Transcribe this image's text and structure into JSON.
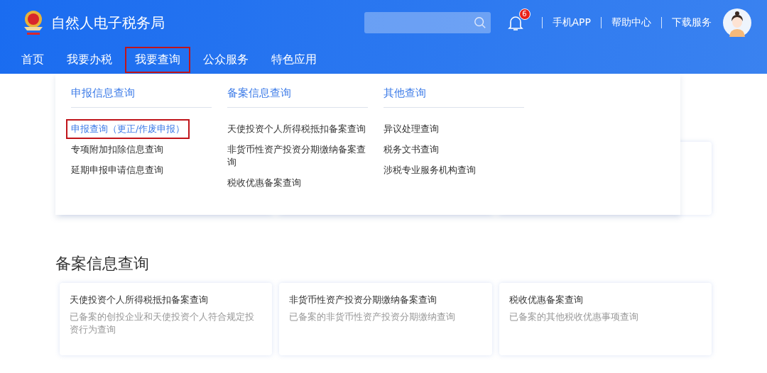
{
  "header": {
    "title": "自然人电子税务局",
    "notification_count": "6",
    "links": [
      "手机APP",
      "帮助中心",
      "下载服务"
    ]
  },
  "nav": [
    {
      "label": "首页",
      "highlighted": false
    },
    {
      "label": "我要办税",
      "highlighted": false
    },
    {
      "label": "我要查询",
      "highlighted": true
    },
    {
      "label": "公众服务",
      "highlighted": false
    },
    {
      "label": "特色应用",
      "highlighted": false
    }
  ],
  "dropdown": {
    "columns": [
      {
        "heading": "申报信息查询",
        "items": [
          {
            "label": "申报查询（更正/作废申报）",
            "selected": true
          },
          {
            "label": "专项附加扣除信息查询",
            "selected": false
          },
          {
            "label": "延期申报申请信息查询",
            "selected": false
          }
        ]
      },
      {
        "heading": "备案信息查询",
        "items": [
          {
            "label": "天使投资个人所得税抵扣备案查询",
            "selected": false
          },
          {
            "label": "非货币性资产投资分期缴纳备案查询",
            "selected": false
          },
          {
            "label": "税收优惠备案查询",
            "selected": false
          }
        ]
      },
      {
        "heading": "其他查询",
        "items": [
          {
            "label": "异议处理查询",
            "selected": false
          },
          {
            "label": "税务文书查询",
            "selected": false
          },
          {
            "label": "涉税专业服务机构查询",
            "selected": false
          }
        ]
      }
    ]
  },
  "section": {
    "title": "备案信息查询",
    "cards": [
      {
        "title": "天使投资个人所得税抵扣备案查询",
        "description": "已备案的创投企业和天使投资个人符合规定投资行为查询"
      },
      {
        "title": "非货币性资产投资分期缴纳备案查询",
        "description": "已备案的非货币性资产投资分期缴纳查询"
      },
      {
        "title": "税收优惠备案查询",
        "description": "已备案的其他税收优惠事项查询"
      }
    ]
  }
}
